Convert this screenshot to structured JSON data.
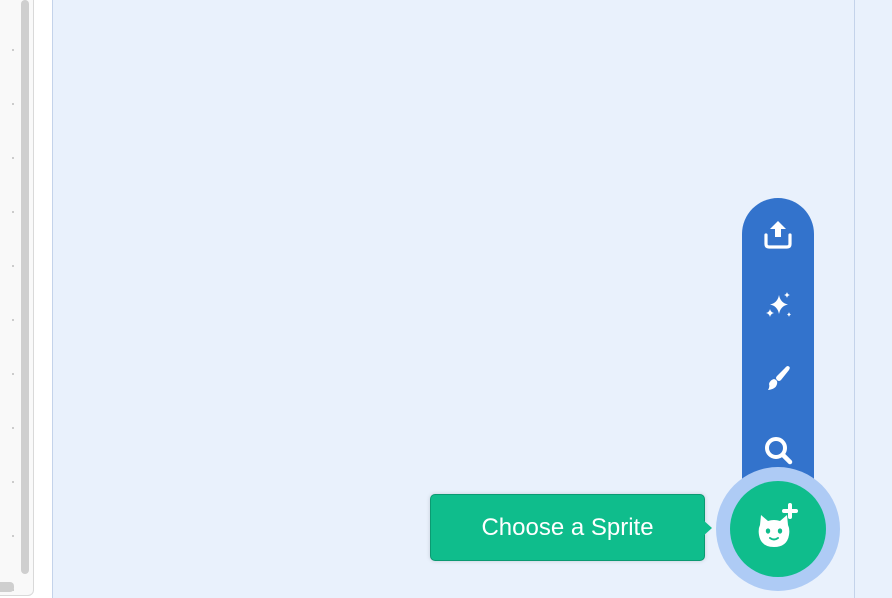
{
  "sprite_menu": {
    "tooltip_label": "Choose a Sprite",
    "items": [
      {
        "icon": "upload-icon"
      },
      {
        "icon": "surprise-icon"
      },
      {
        "icon": "paint-icon"
      },
      {
        "icon": "search-icon"
      }
    ],
    "main_icon": "cat-add-icon"
  },
  "colors": {
    "flyout": "#3373cc",
    "primary": "#0fbd8c",
    "ring": "#aecbf5",
    "pane_background": "#e9f1fc"
  }
}
